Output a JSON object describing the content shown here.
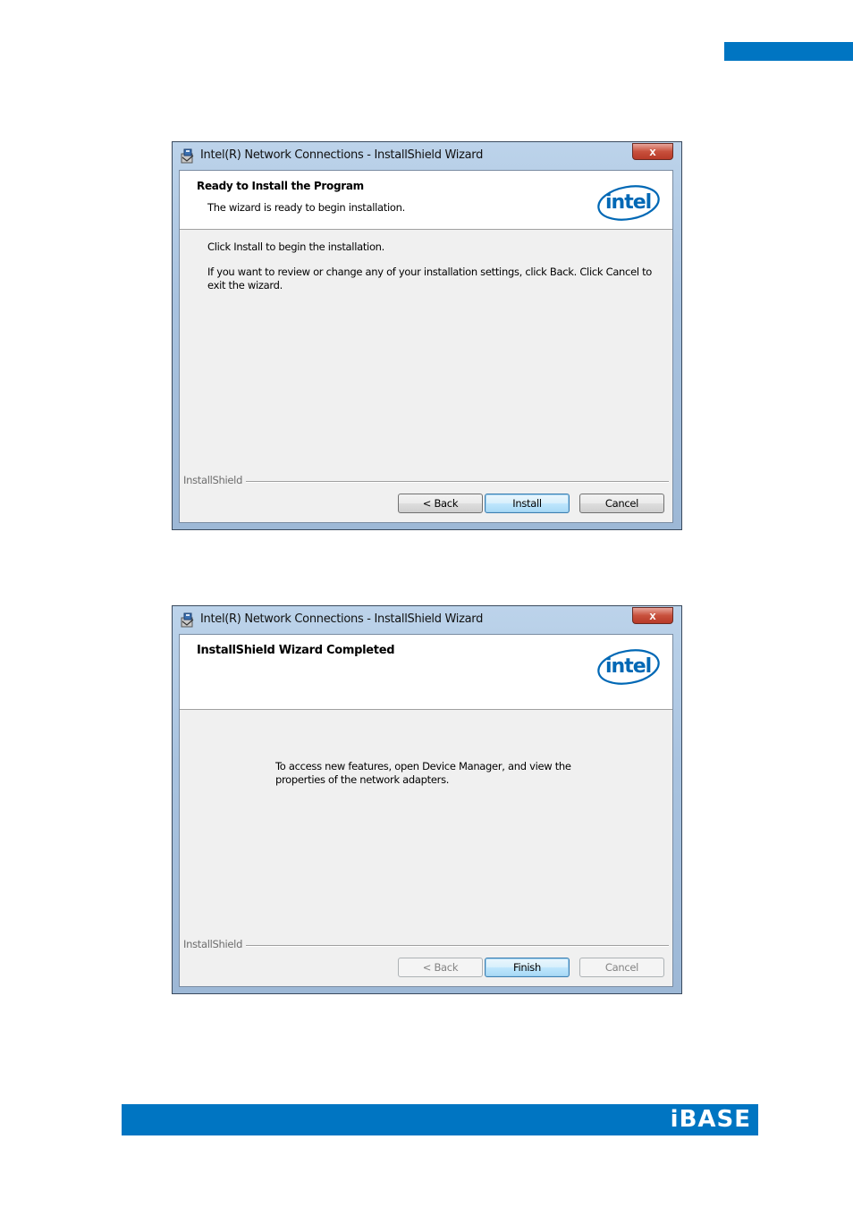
{
  "page": {
    "brand_logo": "iBASE"
  },
  "dialog1": {
    "title": "Intel(R) Network Connections - InstallShield Wizard",
    "close_label": "x",
    "header_title": "Ready to Install the Program",
    "header_subtitle": "The wizard is ready to begin installation.",
    "logo_text": "intel",
    "body_line1": "Click Install to begin the installation.",
    "body_line2": "If you want to review or change any of your installation settings, click Back. Click Cancel to exit the wizard.",
    "installshield_label": "InstallShield",
    "buttons": {
      "back": "< Back",
      "install": "Install",
      "cancel": "Cancel"
    }
  },
  "dialog2": {
    "title": "Intel(R) Network Connections - InstallShield Wizard",
    "close_label": "x",
    "header_title": "InstallShield Wizard Completed",
    "logo_text": "intel",
    "body_text": "To access new features, open Device Manager, and view the properties of the network adapters.",
    "installshield_label": "InstallShield",
    "buttons": {
      "back": "< Back",
      "finish": "Finish",
      "cancel": "Cancel"
    }
  },
  "colors": {
    "brand_blue": "#0075c2",
    "intel_blue": "#0068b5"
  },
  "icons": [
    "installer-icon",
    "close-icon",
    "intel-logo",
    "ibase-logo"
  ]
}
